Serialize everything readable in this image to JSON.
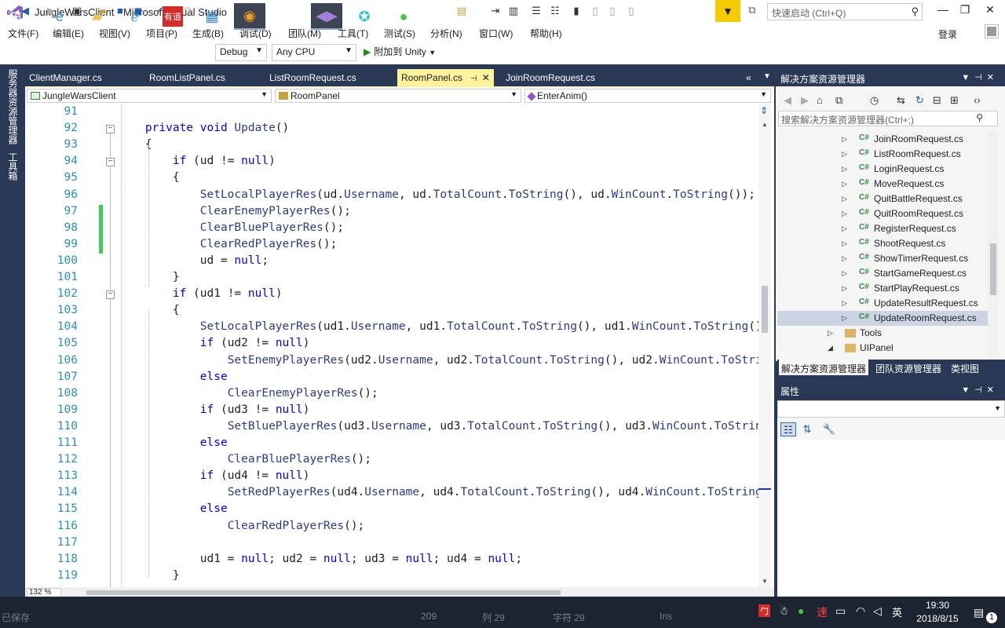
{
  "window": {
    "title": "JungleWarsClient - Microsoft Visual Studio",
    "quick_launch_placeholder": "快速启动 (Ctrl+Q)"
  },
  "menu": [
    "文件(F)",
    "编辑(E)",
    "视图(V)",
    "项目(P)",
    "生成(B)",
    "调试(D)",
    "团队(M)",
    "工具(T)",
    "测试(S)",
    "分析(N)",
    "窗口(W)",
    "帮助(H)"
  ],
  "login_label": "登录",
  "toolbar": {
    "config": "Debug",
    "platform": "Any CPU",
    "attach": "附加到 Unity"
  },
  "left_strip": [
    "服务器资源管理器",
    "工具箱"
  ],
  "tabs": [
    {
      "label": "ClientManager.cs",
      "active": false
    },
    {
      "label": "RoomListPanel.cs",
      "active": false
    },
    {
      "label": "ListRoomRequest.cs",
      "active": false
    },
    {
      "label": "RoomPanel.cs",
      "active": true
    },
    {
      "label": "JoinRoomRequest.cs",
      "active": false
    }
  ],
  "nav": {
    "project": "JungleWarsClient",
    "type": "RoomPanel",
    "member": "EnterAnim()"
  },
  "code_lines": [
    {
      "n": "91",
      "t": ""
    },
    {
      "n": "92",
      "t": "    <span class='kw'>private</span> <span class='kw'>void</span> <span class='mt'>Update</span>()"
    },
    {
      "n": "93",
      "t": "    {"
    },
    {
      "n": "94",
      "t": "        <span class='kw'>if</span> (ud != <span class='kw'>null</span>)"
    },
    {
      "n": "95",
      "t": "        {"
    },
    {
      "n": "96",
      "t": "            <span class='mt'>SetLocalPlayerRes</span>(ud.<span class='mt'>Username</span>, ud.<span class='mt'>TotalCount</span>.<span class='mt'>ToString</span>(), ud.<span class='mt'>WinCount</span>.<span class='mt'>ToString</span>());"
    },
    {
      "n": "97",
      "t": "            <span class='mt'>ClearEnemyPlayerRes</span>();"
    },
    {
      "n": "98",
      "t": "            <span class='mt'>ClearBluePlayerRes</span>();"
    },
    {
      "n": "99",
      "t": "            <span class='mt'>ClearRedPlayerRes</span>();"
    },
    {
      "n": "100",
      "t": "            ud = <span class='kw'>null</span>;"
    },
    {
      "n": "101",
      "t": "        }"
    },
    {
      "n": "102",
      "t": "        <span class='kw'>if</span> (ud1 != <span class='kw'>null</span>)"
    },
    {
      "n": "103",
      "t": "        {"
    },
    {
      "n": "104",
      "t": "            <span class='mt'>SetLocalPlayerRes</span>(ud1.<span class='mt'>Username</span>, ud1.<span class='mt'>TotalCount</span>.<span class='mt'>ToString</span>(), ud1.<span class='mt'>WinCount</span>.<span class='mt'>ToString</span>())"
    },
    {
      "n": "105",
      "t": "            <span class='kw'>if</span> (ud2 != <span class='kw'>null</span>)"
    },
    {
      "n": "106",
      "t": "                <span class='mt'>SetEnemyPlayerRes</span>(ud2.<span class='mt'>Username</span>, ud2.<span class='mt'>TotalCount</span>.<span class='mt'>ToString</span>(), ud2.<span class='mt'>WinCount</span>.<span class='mt'>ToStrin</span>"
    },
    {
      "n": "107",
      "t": "            <span class='kw'>else</span>"
    },
    {
      "n": "108",
      "t": "                <span class='mt'>ClearEnemyPlayerRes</span>();"
    },
    {
      "n": "109",
      "t": "            <span class='kw'>if</span> (ud3 != <span class='kw'>null</span>)"
    },
    {
      "n": "110",
      "t": "                <span class='mt'>SetBluePlayerRes</span>(ud3.<span class='mt'>Username</span>, ud3.<span class='mt'>TotalCount</span>.<span class='mt'>ToString</span>(), ud3.<span class='mt'>WinCount</span>.<span class='mt'>ToString</span>"
    },
    {
      "n": "111",
      "t": "            <span class='kw'>else</span>"
    },
    {
      "n": "112",
      "t": "                <span class='mt'>ClearBluePlayerRes</span>();"
    },
    {
      "n": "113",
      "t": "            <span class='kw'>if</span> (ud4 != <span class='kw'>null</span>)"
    },
    {
      "n": "114",
      "t": "                <span class='mt'>SetRedPlayerRes</span>(ud4.<span class='mt'>Username</span>, ud4.<span class='mt'>TotalCount</span>.<span class='mt'>ToString</span>(), ud4.<span class='mt'>WinCount</span>.<span class='mt'>ToString</span>("
    },
    {
      "n": "115",
      "t": "            <span class='kw'>else</span>"
    },
    {
      "n": "116",
      "t": "                <span class='mt'>ClearRedPlayerRes</span>();"
    },
    {
      "n": "117",
      "t": ""
    },
    {
      "n": "118",
      "t": "            ud1 = <span class='kw'>null</span>; ud2 = <span class='kw'>null</span>; ud3 = <span class='kw'>null</span>; ud4 = <span class='kw'>null</span>;"
    },
    {
      "n": "119",
      "t": "        }"
    }
  ],
  "zoom": "132 %",
  "solution_explorer": {
    "title": "解决方案资源管理器",
    "search_placeholder": "搜索解决方案资源管理器(Ctrl+;)",
    "items": [
      {
        "label": "JoinRoomRequest.cs",
        "type": "cs"
      },
      {
        "label": "ListRoomRequest.cs",
        "type": "cs"
      },
      {
        "label": "LoginRequest.cs",
        "type": "cs"
      },
      {
        "label": "MoveRequest.cs",
        "type": "cs"
      },
      {
        "label": "QuitBattleRequest.cs",
        "type": "cs"
      },
      {
        "label": "QuitRoomRequest.cs",
        "type": "cs"
      },
      {
        "label": "RegisterRequest.cs",
        "type": "cs"
      },
      {
        "label": "ShootRequest.cs",
        "type": "cs"
      },
      {
        "label": "ShowTimerRequest.cs",
        "type": "cs"
      },
      {
        "label": "StartGameRequest.cs",
        "type": "cs"
      },
      {
        "label": "StartPlayRequest.cs",
        "type": "cs"
      },
      {
        "label": "UpdateResultRequest.cs",
        "type": "cs"
      },
      {
        "label": "UpdateRoomRequest.cs",
        "type": "cs",
        "selected": true
      },
      {
        "label": "Tools",
        "type": "folder"
      },
      {
        "label": "UIPanel",
        "type": "folder-open"
      }
    ],
    "tabs": [
      "解决方案资源管理器",
      "团队资源管理器",
      "类视图"
    ]
  },
  "properties": {
    "title": "属性"
  },
  "status_ghost": {
    "ready": "已保存",
    "line": "209",
    "col": "列 29",
    "char": "字符 29",
    "ins": "Ins"
  },
  "taskbar": {
    "time": "19:30",
    "date": "2018/8/15",
    "ime": "英",
    "notification_count": "1"
  },
  "colors": {
    "accent": "#293955",
    "active_tab": "#fff29d",
    "keyword": "#0000ff",
    "line_number": "#2b91af",
    "change_bar": "#3fcc5a"
  }
}
